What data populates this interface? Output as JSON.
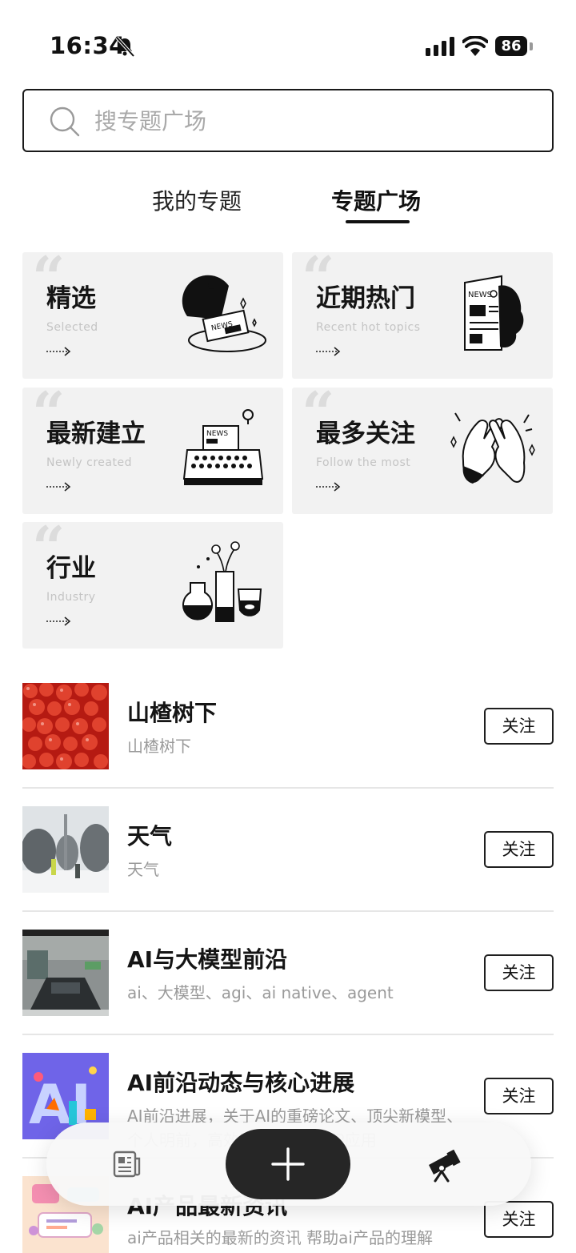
{
  "status_bar": {
    "time": "16:34",
    "battery": "86"
  },
  "search": {
    "placeholder": "搜专题广场"
  },
  "tabs": [
    {
      "label": "我的专题",
      "active": false
    },
    {
      "label": "专题广场",
      "active": true
    }
  ],
  "categories": [
    {
      "title": "精选",
      "subtitle": "Selected",
      "icon": "cloche-news-icon"
    },
    {
      "title": "近期热门",
      "subtitle": "Recent hot topics",
      "icon": "newspaper-icon"
    },
    {
      "title": "最新建立",
      "subtitle": "Newly created",
      "icon": "typewriter-icon"
    },
    {
      "title": "最多关注",
      "subtitle": "Follow the most",
      "icon": "high-five-icon"
    },
    {
      "title": "行业",
      "subtitle": "Industry",
      "icon": "flasks-icon"
    }
  ],
  "topics": [
    {
      "name": "山楂树下",
      "desc": "山楂树下",
      "follow_label": "关注",
      "thumb": "hawthorn-berries"
    },
    {
      "name": "天气",
      "desc": "天气",
      "follow_label": "关注",
      "thumb": "snowy-street"
    },
    {
      "name": "AI与大模型前沿",
      "desc": "ai、大模型、agi、ai native、agent",
      "follow_label": "关注",
      "thumb": "parking-garage"
    },
    {
      "name": "AI前沿动态与核心进展",
      "desc": "AI前沿进展，关于AI的重磅论文、顶尖新模型、个人明前，高效iOS应用程序iP应用",
      "follow_label": "关注",
      "thumb": "ai-poster"
    },
    {
      "name": "AI产品最新资讯",
      "desc": "ai产品相关的最新的资讯 帮助ai产品的理解",
      "follow_label": "关注",
      "thumb": "app-collage"
    }
  ],
  "bottom_nav": {
    "left_icon": "news-icon",
    "center_icon": "plus-icon",
    "right_icon": "telescope-icon"
  },
  "colors": {
    "accent": "#111111",
    "card_bg": "#f2f2f2",
    "muted_text": "#9a9a9a"
  }
}
